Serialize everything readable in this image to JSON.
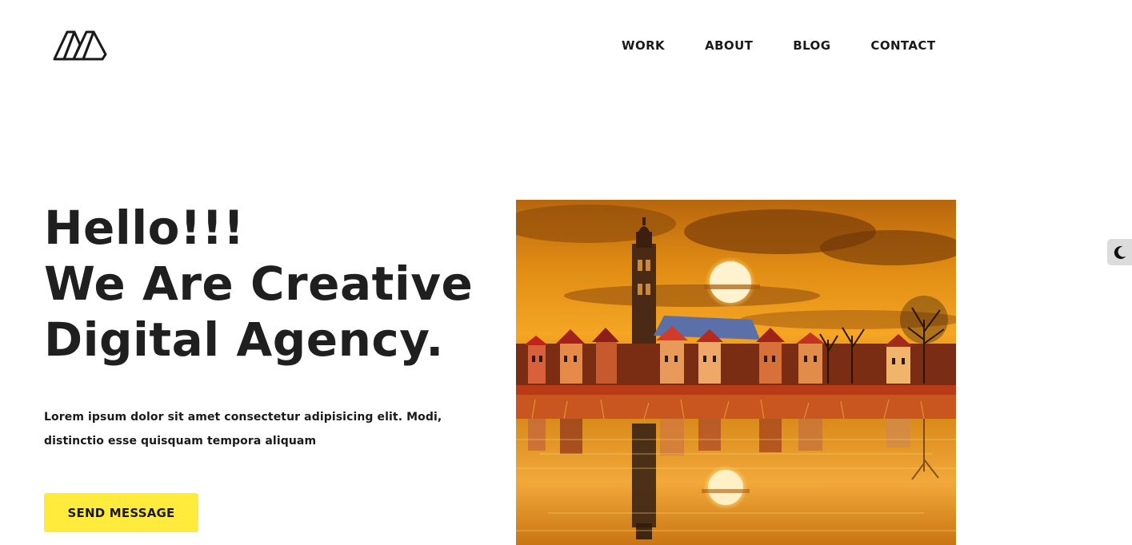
{
  "header": {
    "logo": "m-logo-icon",
    "nav": [
      {
        "label": "WORK"
      },
      {
        "label": "ABOUT"
      },
      {
        "label": "BLOG"
      },
      {
        "label": "CONTACT"
      }
    ]
  },
  "hero": {
    "title_lines": [
      "Hello!!!",
      "We Are Creative",
      "Digital Agency."
    ],
    "description": "Lorem ipsum dolor sit amet consectetur adipisicing elit. Modi, distinctio esse quisquam tempora aliquam",
    "cta_label": "SEND MESSAGE",
    "image": "sunset-city-reflection-image"
  },
  "theme_toggle": {
    "icon": "moon-icon"
  },
  "colors": {
    "accent": "#ffeb3b",
    "text": "#1a1a1a",
    "background": "#ffffff",
    "toggle_bg": "#dcdcdc"
  }
}
